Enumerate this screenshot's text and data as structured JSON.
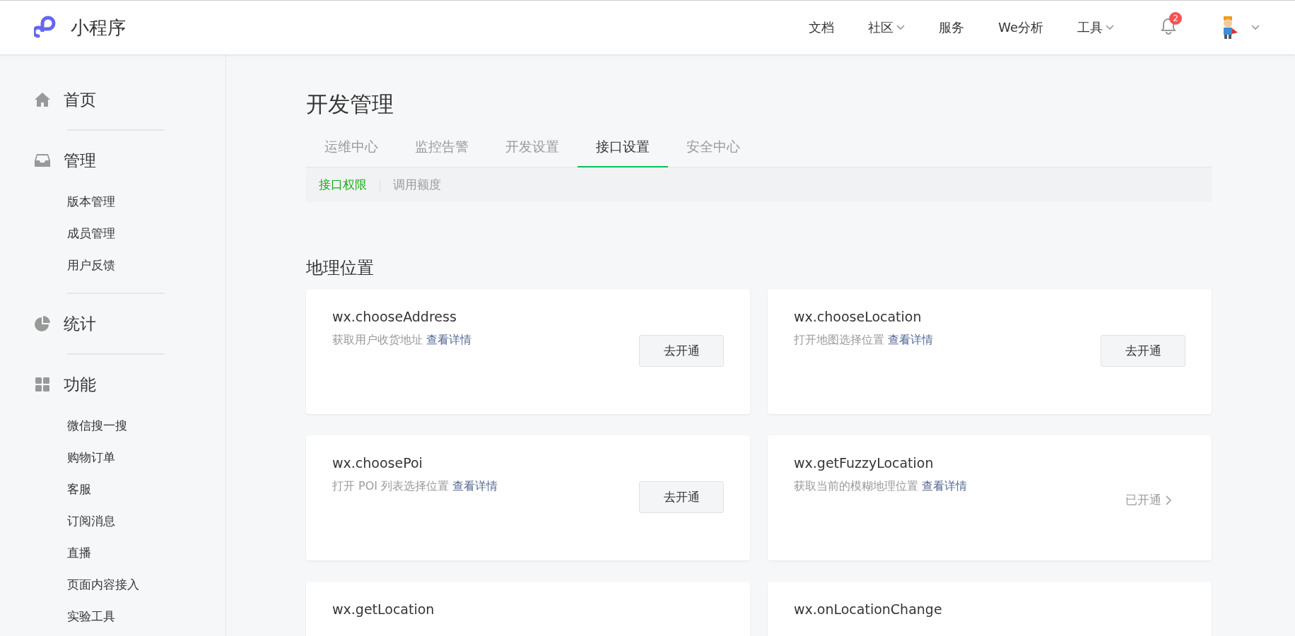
{
  "header": {
    "logo_text": "小程序",
    "nav": [
      {
        "label": "文档",
        "dropdown": false
      },
      {
        "label": "社区",
        "dropdown": true
      },
      {
        "label": "服务",
        "dropdown": false
      },
      {
        "label": "We分析",
        "dropdown": false
      },
      {
        "label": "工具",
        "dropdown": true
      }
    ],
    "notification_count": "2"
  },
  "sidebar": {
    "sections": [
      {
        "label": "首页"
      },
      {
        "label": "管理",
        "items": [
          "版本管理",
          "成员管理",
          "用户反馈"
        ]
      },
      {
        "label": "统计"
      },
      {
        "label": "功能",
        "items": [
          "微信搜一搜",
          "购物订单",
          "客服",
          "订阅消息",
          "直播",
          "页面内容接入",
          "实验工具"
        ]
      }
    ]
  },
  "page_title": "开发管理",
  "tabs": [
    {
      "label": "运维中心",
      "selected": false
    },
    {
      "label": "监控告警",
      "selected": false
    },
    {
      "label": "开发设置",
      "selected": false
    },
    {
      "label": "接口设置",
      "selected": true
    },
    {
      "label": "安全中心",
      "selected": false
    }
  ],
  "subtabs": [
    {
      "label": "接口权限",
      "selected": true
    },
    {
      "label": "调用额度",
      "selected": false
    }
  ],
  "section_title": "地理位置",
  "cards": [
    {
      "title": "wx.chooseAddress",
      "description": "获取用户收货地址",
      "link": "查看详情",
      "action": {
        "kind": "button",
        "label": "去开通"
      }
    },
    {
      "title": "wx.chooseLocation",
      "description": "打开地图选择位置",
      "link": "查看详情",
      "action": {
        "kind": "button",
        "label": "去开通"
      }
    },
    {
      "title": "wx.choosePoi",
      "description": "打开 POI 列表选择位置",
      "link": "查看详情",
      "action": {
        "kind": "button",
        "label": "去开通"
      }
    },
    {
      "title": "wx.getFuzzyLocation",
      "description": "获取当前的模糊地理位置",
      "link": "查看详情",
      "action": {
        "kind": "status",
        "label": "已开通"
      }
    },
    {
      "title": "wx.getLocation"
    },
    {
      "title": "wx.onLocationChange"
    }
  ]
}
